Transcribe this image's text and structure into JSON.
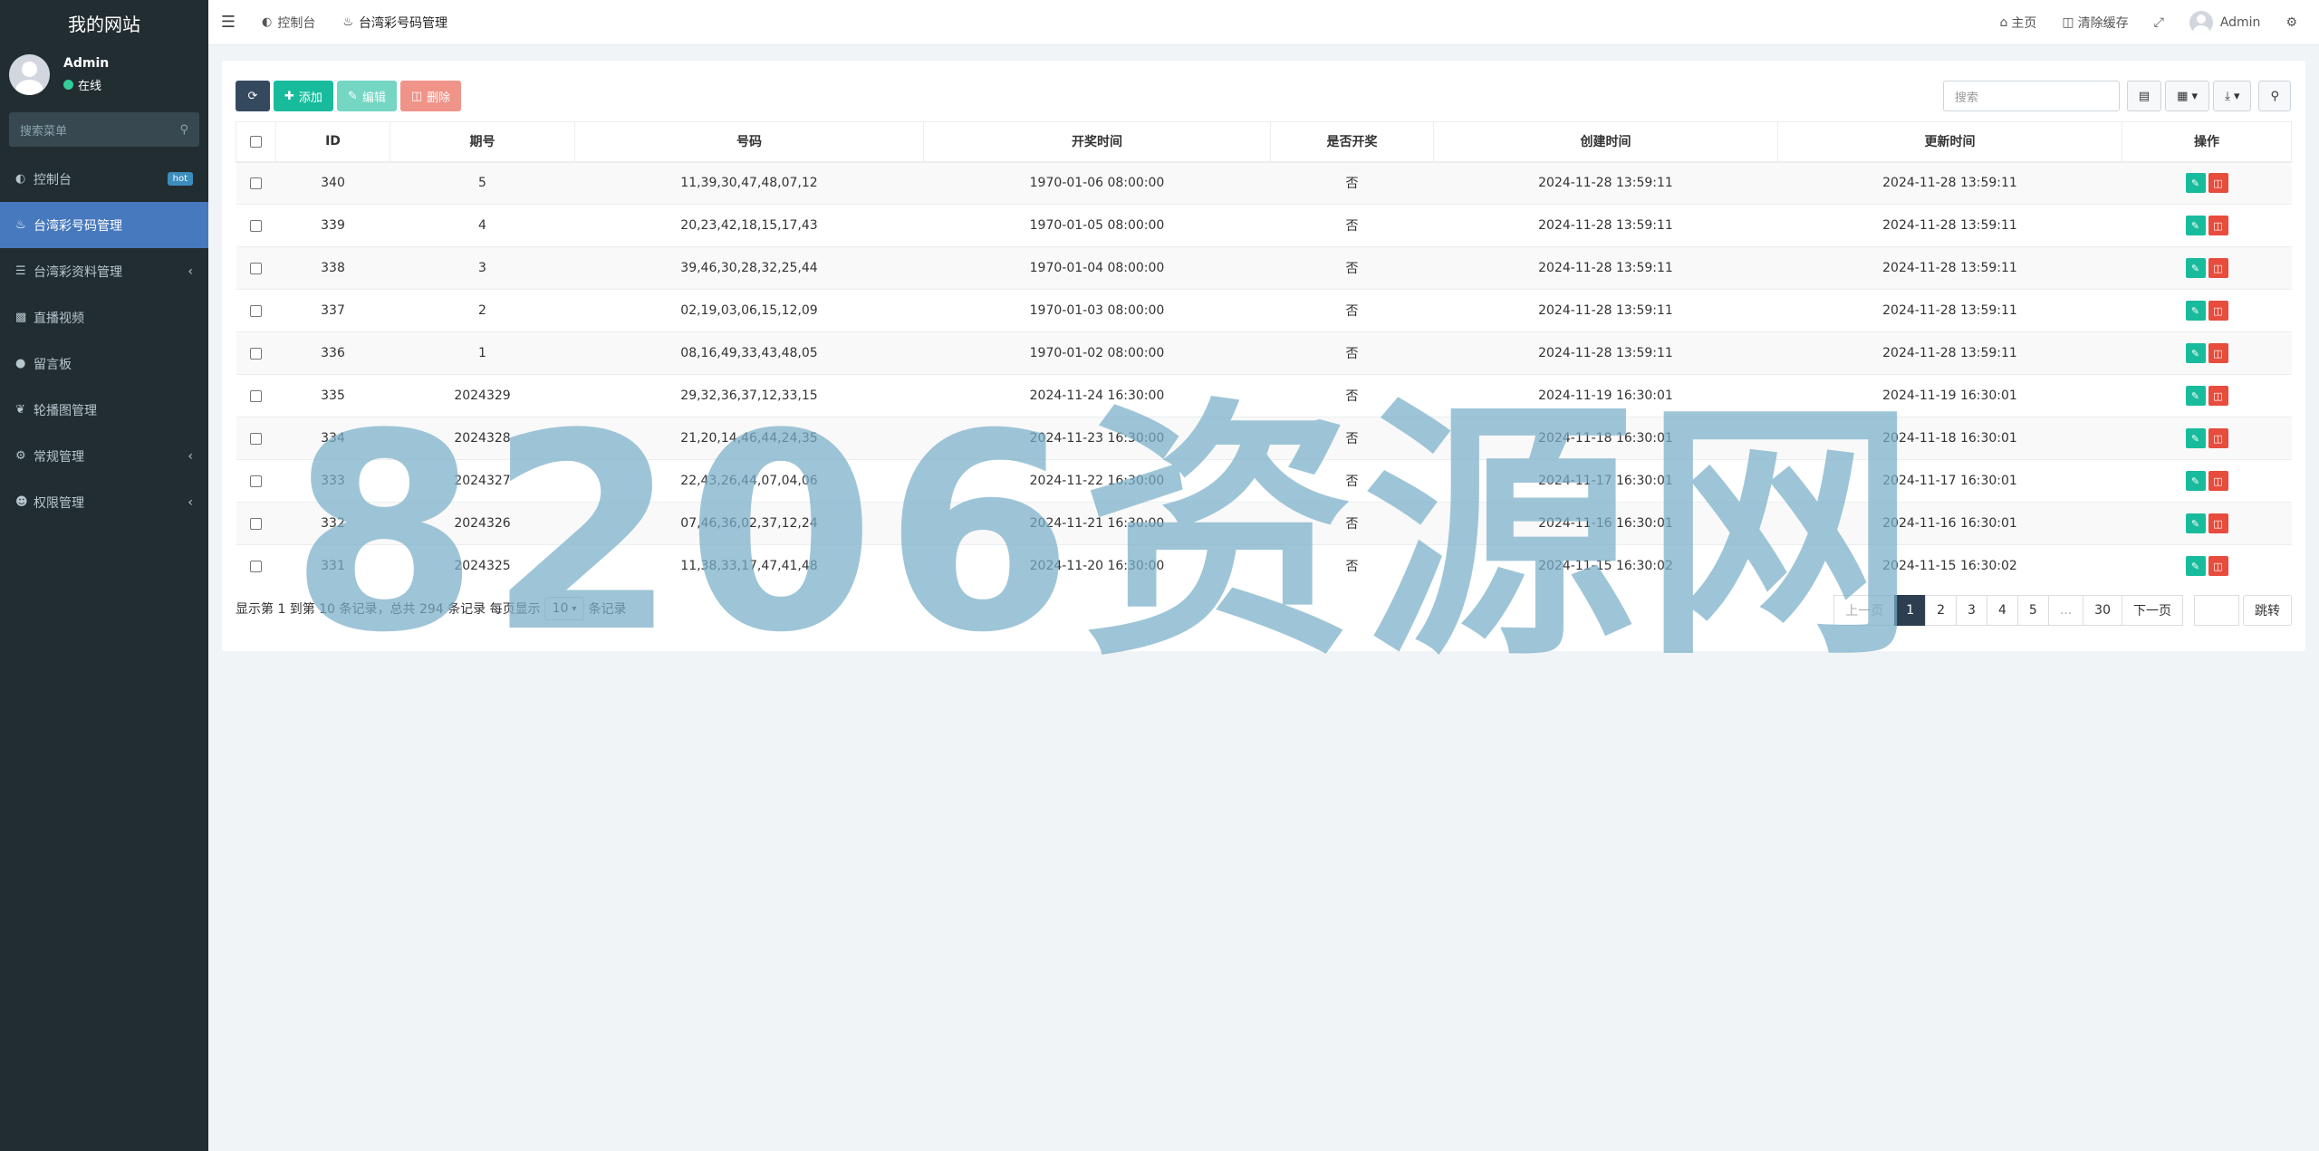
{
  "sidebar": {
    "logo": "我的网站",
    "user": {
      "name": "Admin",
      "status": "在线"
    },
    "search_placeholder": "搜索菜单",
    "items": [
      {
        "label": "控制台",
        "icon": "dashboard-icon",
        "badge": "hot"
      },
      {
        "label": "台湾彩号码管理",
        "icon": "bell-icon",
        "active": true
      },
      {
        "label": "台湾彩资料管理",
        "icon": "list-icon",
        "has_children": true
      },
      {
        "label": "直播视频",
        "icon": "video-icon"
      },
      {
        "label": "留言板",
        "icon": "comment-icon"
      },
      {
        "label": "轮播图管理",
        "icon": "leaf-icon"
      },
      {
        "label": "常规管理",
        "icon": "cogs-icon",
        "has_children": true
      },
      {
        "label": "权限管理",
        "icon": "users-icon",
        "has_children": true
      }
    ]
  },
  "header": {
    "tabs": [
      {
        "label": "控制台",
        "icon": "dashboard-icon"
      },
      {
        "label": "台湾彩号码管理",
        "icon": "bell-icon",
        "active": true
      }
    ],
    "right": {
      "home": "主页",
      "clear_cache": "清除缓存",
      "user": "Admin"
    }
  },
  "toolbar": {
    "add": "添加",
    "edit": "编辑",
    "delete": "删除",
    "search_placeholder": "搜索"
  },
  "table": {
    "columns": [
      "ID",
      "期号",
      "号码",
      "开奖时间",
      "是否开奖",
      "创建时间",
      "更新时间",
      "操作"
    ],
    "rows": [
      [
        "340",
        "5",
        "11,39,30,47,48,07,12",
        "1970-01-06 08:00:00",
        "否",
        "2024-11-28 13:59:11",
        "2024-11-28 13:59:11"
      ],
      [
        "339",
        "4",
        "20,23,42,18,15,17,43",
        "1970-01-05 08:00:00",
        "否",
        "2024-11-28 13:59:11",
        "2024-11-28 13:59:11"
      ],
      [
        "338",
        "3",
        "39,46,30,28,32,25,44",
        "1970-01-04 08:00:00",
        "否",
        "2024-11-28 13:59:11",
        "2024-11-28 13:59:11"
      ],
      [
        "337",
        "2",
        "02,19,03,06,15,12,09",
        "1970-01-03 08:00:00",
        "否",
        "2024-11-28 13:59:11",
        "2024-11-28 13:59:11"
      ],
      [
        "336",
        "1",
        "08,16,49,33,43,48,05",
        "1970-01-02 08:00:00",
        "否",
        "2024-11-28 13:59:11",
        "2024-11-28 13:59:11"
      ],
      [
        "335",
        "2024329",
        "29,32,36,37,12,33,15",
        "2024-11-24 16:30:00",
        "否",
        "2024-11-19 16:30:01",
        "2024-11-19 16:30:01"
      ],
      [
        "334",
        "2024328",
        "21,20,14,46,44,24,35",
        "2024-11-23 16:30:00",
        "否",
        "2024-11-18 16:30:01",
        "2024-11-18 16:30:01"
      ],
      [
        "333",
        "2024327",
        "22,43,26,44,07,04,06",
        "2024-11-22 16:30:00",
        "否",
        "2024-11-17 16:30:01",
        "2024-11-17 16:30:01"
      ],
      [
        "332",
        "2024326",
        "07,46,36,02,37,12,24",
        "2024-11-21 16:30:00",
        "否",
        "2024-11-16 16:30:01",
        "2024-11-16 16:30:01"
      ],
      [
        "331",
        "2024325",
        "11,38,33,17,47,41,48",
        "2024-11-20 16:30:00",
        "否",
        "2024-11-15 16:30:02",
        "2024-11-15 16:30:02"
      ]
    ]
  },
  "pager": {
    "info_prefix": "显示第 1 到第 10 条记录，总共 294 条记录 每页显示",
    "page_size": "10",
    "info_suffix": "条记录",
    "prev": "上一页",
    "pages": [
      "1",
      "2",
      "3",
      "4",
      "5",
      "...",
      "30"
    ],
    "next": "下一页",
    "jump": "跳转"
  },
  "watermark": "8206资源网",
  "colors": {
    "sidebar_bg": "#222d32",
    "active_menu": "#4679bd",
    "success": "#18bc9c",
    "danger": "#e74c3c",
    "primary_dark": "#2c3e50"
  }
}
